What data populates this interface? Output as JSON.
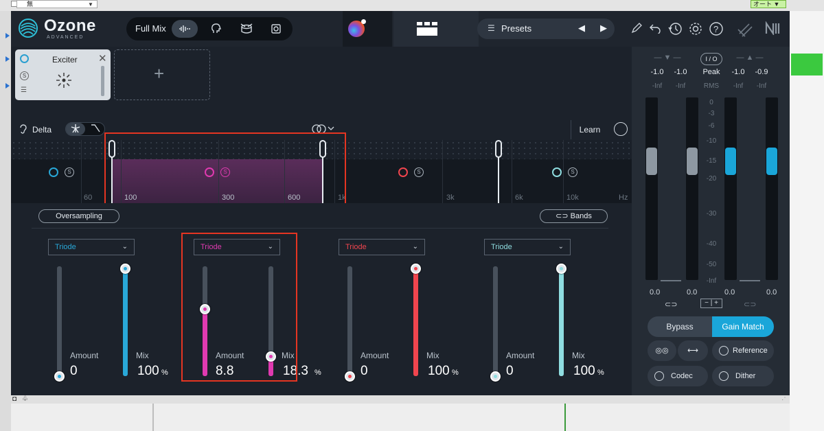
{
  "host": {
    "select_value": "無",
    "auto_label": "オート ▼"
  },
  "header": {
    "logo": "Ozone",
    "logo_sub": "ADVANCED",
    "mode_label": "Full Mix",
    "presets_label": "Presets"
  },
  "module": {
    "name": "Exciter",
    "solo": "S"
  },
  "toolbar": {
    "delta_label": "Delta",
    "learn_label": "Learn"
  },
  "spectrum": {
    "freq_labels": [
      "60",
      "100",
      "300",
      "600",
      "1k",
      "3k",
      "6k",
      "10k",
      "Hz"
    ],
    "band_colors": [
      "#29a8d8",
      "#e03ab0",
      "#f0454e",
      "#8fdde0"
    ],
    "solo_label": "S"
  },
  "controls": {
    "oversampling_label": "Oversampling",
    "bands_label": "Bands",
    "amount_label": "Amount",
    "mix_label": "Mix",
    "percent": "%",
    "bands": [
      {
        "mode": "Triode",
        "amount": "0",
        "mix": "100",
        "amount_level": 0.0,
        "mix_level": 1.0
      },
      {
        "mode": "Triode",
        "amount": "8.8",
        "mix": "18.3",
        "amount_level": 0.61,
        "mix_level": 0.183
      },
      {
        "mode": "Triode",
        "amount": "0",
        "mix": "100",
        "amount_level": 0.0,
        "mix_level": 1.0
      },
      {
        "mode": "Triode",
        "amount": "0",
        "mix": "100",
        "amount_level": 0.0,
        "mix_level": 1.0
      }
    ]
  },
  "meter": {
    "io_label": "I / O",
    "peak_label": "Peak",
    "rms_label": "RMS",
    "in_l": "-1.0",
    "in_r": "-1.0",
    "out_l": "-1.0",
    "out_r": "-0.9",
    "inf": "-Inf",
    "scale": [
      "0",
      "-3",
      "-6",
      "-10",
      "-15",
      "-20",
      "-30",
      "-40",
      "-50",
      "-Inf"
    ],
    "gain_in_l": "0.0",
    "gain_in_r": "0.0",
    "gain_out_l": "0.0",
    "gain_out_r": "0.0",
    "bypass_label": "Bypass",
    "gain_match_label": "Gain Match",
    "reference_label": "Reference",
    "codec_label": "Codec",
    "dither_label": "Dither"
  }
}
